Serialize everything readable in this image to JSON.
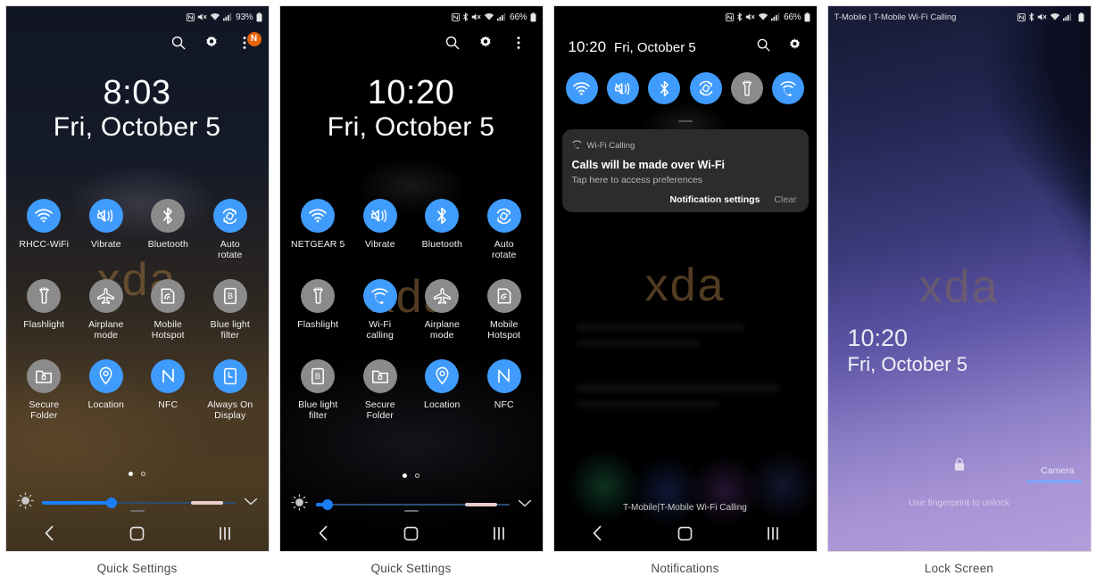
{
  "panels": [
    {
      "caption": "Quick Settings",
      "statusbar": {
        "left": "",
        "icons": [
          "nfc-icon",
          "mute-icon",
          "wifi-icon",
          "signal-icon"
        ],
        "battery_pct": "93%"
      },
      "header_icons": [
        "search-icon",
        "gear-icon",
        "more-icon"
      ],
      "badge": "N",
      "clock": {
        "time": "8:03",
        "date": "Fri, October 5"
      },
      "watermark": "xda",
      "tiles": [
        {
          "label": "RHCC-WiFi",
          "icon": "wifi-icon",
          "state": "on"
        },
        {
          "label": "Vibrate",
          "icon": "vibrate-icon",
          "state": "on"
        },
        {
          "label": "Bluetooth",
          "icon": "bluetooth-icon",
          "state": "off"
        },
        {
          "label": "Auto\nrotate",
          "icon": "auto-rotate-icon",
          "state": "on"
        },
        {
          "label": "Flashlight",
          "icon": "flashlight-icon",
          "state": "off"
        },
        {
          "label": "Airplane\nmode",
          "icon": "airplane-icon",
          "state": "off"
        },
        {
          "label": "Mobile\nHotspot",
          "icon": "hotspot-icon",
          "state": "off"
        },
        {
          "label": "Blue light\nfilter",
          "icon": "blue-light-icon",
          "state": "off"
        },
        {
          "label": "Secure\nFolder",
          "icon": "secure-folder-icon",
          "state": "off"
        },
        {
          "label": "Location",
          "icon": "location-icon",
          "state": "on"
        },
        {
          "label": "NFC",
          "icon": "nfc-icon",
          "state": "on"
        },
        {
          "label": "Always On\nDisplay",
          "icon": "always-on-display-icon",
          "state": "on"
        }
      ],
      "pager": {
        "pages": 2,
        "current": 1
      },
      "brightness": {
        "value_pct": 36,
        "auto_on": true
      },
      "navbar": [
        "back-icon",
        "home-icon",
        "recents-icon"
      ]
    },
    {
      "caption": "Quick Settings",
      "statusbar": {
        "left": "",
        "icons": [
          "nfc-icon",
          "bluetooth-icon",
          "mute-icon",
          "wifi-icon",
          "signal-icon"
        ],
        "battery_pct": "66%"
      },
      "header_icons": [
        "search-icon",
        "gear-icon",
        "more-icon"
      ],
      "badge": "",
      "clock": {
        "time": "10:20",
        "date": "Fri, October 5"
      },
      "watermark": "xda",
      "tiles": [
        {
          "label": "NETGEAR 5",
          "icon": "wifi-icon",
          "state": "on"
        },
        {
          "label": "Vibrate",
          "icon": "vibrate-icon",
          "state": "on"
        },
        {
          "label": "Bluetooth",
          "icon": "bluetooth-icon",
          "state": "on"
        },
        {
          "label": "Auto\nrotate",
          "icon": "auto-rotate-icon",
          "state": "on"
        },
        {
          "label": "Flashlight",
          "icon": "flashlight-icon",
          "state": "off"
        },
        {
          "label": "Wi-Fi\ncalling",
          "icon": "wifi-calling-icon",
          "state": "on"
        },
        {
          "label": "Airplane\nmode",
          "icon": "airplane-icon",
          "state": "off"
        },
        {
          "label": "Mobile\nHotspot",
          "icon": "hotspot-icon",
          "state": "off"
        },
        {
          "label": "Blue light\nfilter",
          "icon": "blue-light-icon",
          "state": "off"
        },
        {
          "label": "Secure\nFolder",
          "icon": "secure-folder-icon",
          "state": "off"
        },
        {
          "label": "Location",
          "icon": "location-icon",
          "state": "on"
        },
        {
          "label": "NFC",
          "icon": "nfc-icon",
          "state": "on"
        }
      ],
      "pager": {
        "pages": 2,
        "current": 1
      },
      "brightness": {
        "value_pct": 6,
        "auto_on": true
      },
      "navbar": [
        "back-icon",
        "home-icon",
        "recents-icon"
      ]
    },
    {
      "caption": "Notifications",
      "statusbar": {
        "left": "",
        "icons": [
          "nfc-icon",
          "bluetooth-icon",
          "mute-icon",
          "wifi-icon",
          "signal-icon"
        ],
        "battery_pct": "66%"
      },
      "header": {
        "time": "10:20",
        "date": "Fri, October 5",
        "icons": [
          "search-icon",
          "gear-icon"
        ]
      },
      "toggles": [
        {
          "icon": "wifi-icon",
          "state": "on"
        },
        {
          "icon": "vibrate-icon",
          "state": "on"
        },
        {
          "icon": "bluetooth-icon",
          "state": "on"
        },
        {
          "icon": "auto-rotate-icon",
          "state": "on"
        },
        {
          "icon": "flashlight-icon",
          "state": "off"
        },
        {
          "icon": "wifi-calling-icon",
          "state": "on"
        }
      ],
      "watermark": "xda",
      "notification": {
        "app": "Wi-Fi Calling",
        "title": "Calls will be made over Wi-Fi",
        "subtitle": "Tap here to access preferences",
        "action_settings": "Notification settings",
        "action_clear": "Clear"
      },
      "carrier_note": "T-Mobile|T-Mobile Wi-Fi Calling",
      "navbar": [
        "back-icon",
        "home-icon",
        "recents-icon"
      ]
    },
    {
      "caption": "Lock Screen",
      "statusbar": {
        "left": "T-Mobile | T-Mobile Wi-Fi Calling",
        "icons": [
          "nfc-icon",
          "bluetooth-icon",
          "mute-icon",
          "wifi-icon",
          "signal-icon"
        ],
        "battery_pct": ""
      },
      "watermark": "xda",
      "clock": {
        "time": "10:20",
        "date": "Fri, October 5"
      },
      "lock_icon": "lock-icon",
      "hint": "Use fingerprint to unlock",
      "camera_label": "Camera"
    }
  ],
  "colors": {
    "accent_on": "#3f9bfc",
    "accent_off": "#8b8b8b",
    "badge": "#e8640a",
    "slider": "#1b7ef5",
    "watermark": "#966e3c"
  }
}
